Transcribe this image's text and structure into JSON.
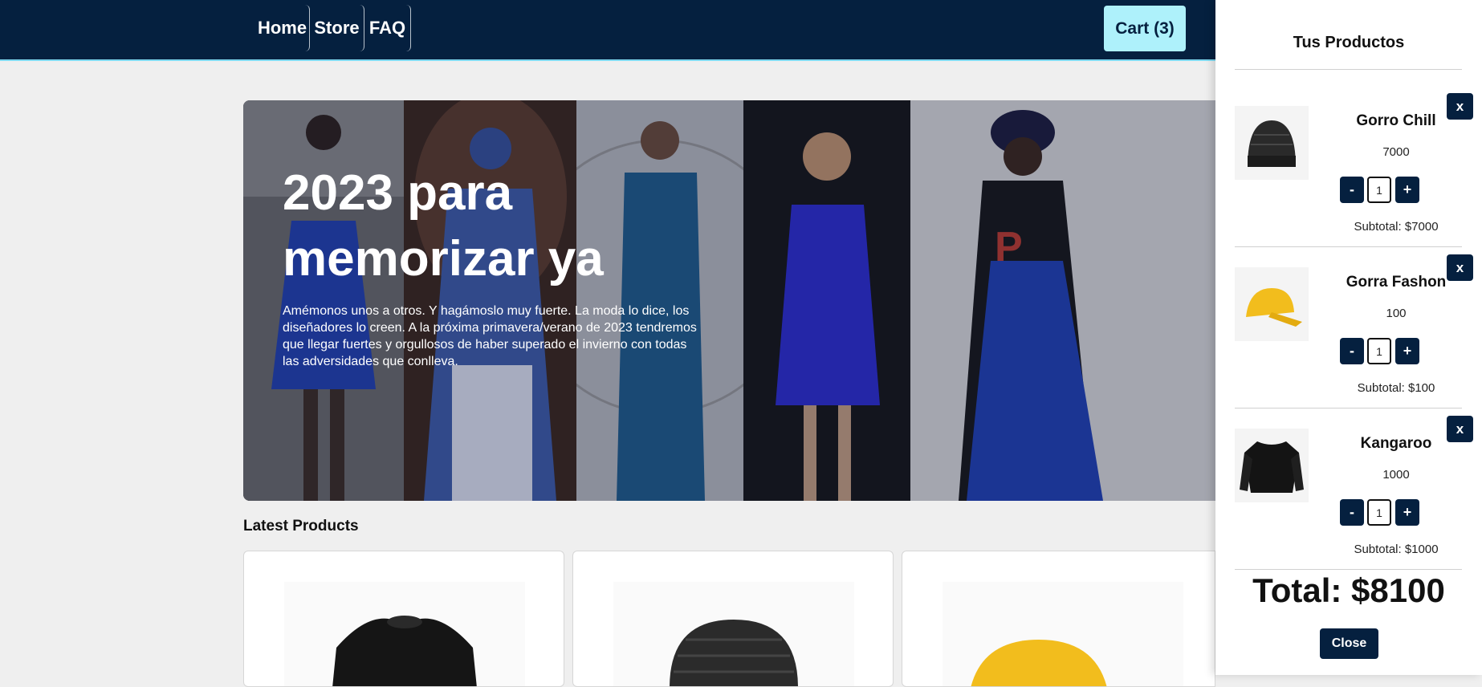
{
  "nav": {
    "links": [
      {
        "label": "Home"
      },
      {
        "label": "Store"
      },
      {
        "label": "FAQ"
      }
    ],
    "cart_label": "Cart (3)"
  },
  "hero": {
    "title": "2023 para memorizar ya",
    "text": "Amémonos unos a otros. Y hagámoslo muy fuerte. La moda lo dice, los diseñadores lo creen. A la próxima primavera/verano de 2023 tendremos que llegar fuertes y orgullosos de haber superado el invierno con todas las adversidades que conlleva."
  },
  "latest": {
    "title": "Latest Products"
  },
  "cart": {
    "title": "Tus Productos",
    "items": [
      {
        "name": "Gorro Chill",
        "price": "7000",
        "qty": "1",
        "subtotal": "Subtotal: $7000",
        "icon": "beanie-icon"
      },
      {
        "name": "Gorra Fashon",
        "price": "100",
        "qty": "1",
        "subtotal": "Subtotal: $100",
        "icon": "cap-icon"
      },
      {
        "name": "Kangaroo",
        "price": "1000",
        "qty": "1",
        "subtotal": "Subtotal: $1000",
        "icon": "sweater-icon"
      }
    ],
    "remove_label": "x",
    "minus_label": "-",
    "plus_label": "+",
    "total": "Total: $8100",
    "close_label": "Close"
  },
  "colors": {
    "navbar": "#05203f",
    "cart_button": "#aef1fb",
    "accent_dark": "#05203f",
    "background": "#efefef"
  }
}
